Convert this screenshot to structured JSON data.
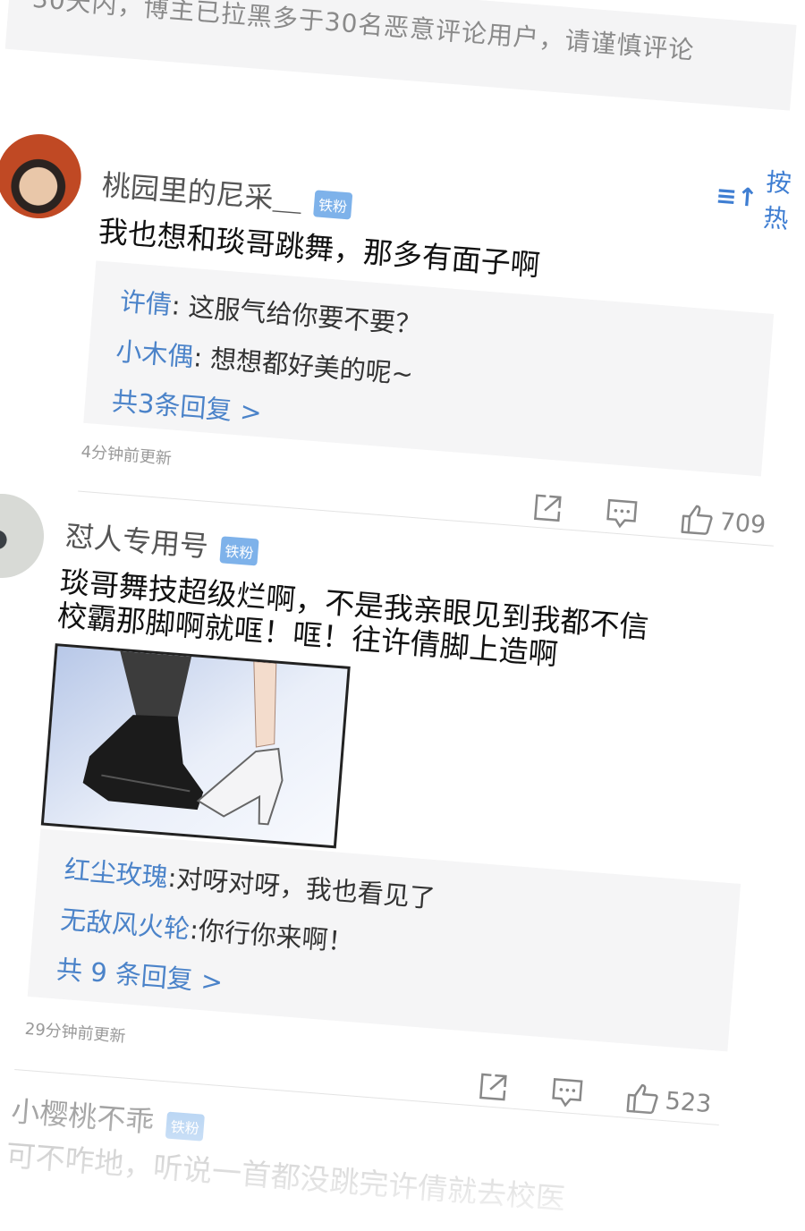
{
  "notice": {
    "text": "30天内，博主已拉黑多于30名恶意评论用户，请谨慎评论"
  },
  "sort": {
    "icon": "sort-icon",
    "label": "按热"
  },
  "comments": [
    {
      "username": "桃园里的尼采＿",
      "badge": "铁粉",
      "text": "我也想和琰哥跳舞，那多有面子啊",
      "replies": [
        {
          "name": "许倩",
          "text": ": 这服气给你要不要？"
        },
        {
          "name": "小木偶",
          "text": ": 想想都好美的呢~"
        }
      ],
      "more": "共3条回复 >",
      "time": "4分钟前更新",
      "likes": "709"
    },
    {
      "username": "怼人专用号",
      "badge": "铁粉",
      "text_line1": "琰哥舞技超级烂啊，不是我亲眼见到我都不信",
      "text_line2": "校霸那脚啊就哐！哐！往许倩脚上造啊",
      "replies": [
        {
          "name": "红尘玫瑰",
          "text": ":对呀对呀，我也看见了"
        },
        {
          "name": "无敌风火轮",
          "text": ":你行你来啊！"
        }
      ],
      "more": "共 9 条回复 >",
      "time": "29分钟前更新",
      "likes": "523"
    },
    {
      "username": "小樱桃不乖",
      "badge": "铁粉",
      "text": "可不咋地，听说一首都没跳完许倩就去校医"
    }
  ],
  "icons": {
    "share": "share-icon",
    "comment": "comment-icon",
    "like": "thumbs-up-icon"
  },
  "colors": {
    "link": "#4b83c9",
    "badge": "#7eb2ea",
    "reply_bg": "#f5f5f6"
  }
}
